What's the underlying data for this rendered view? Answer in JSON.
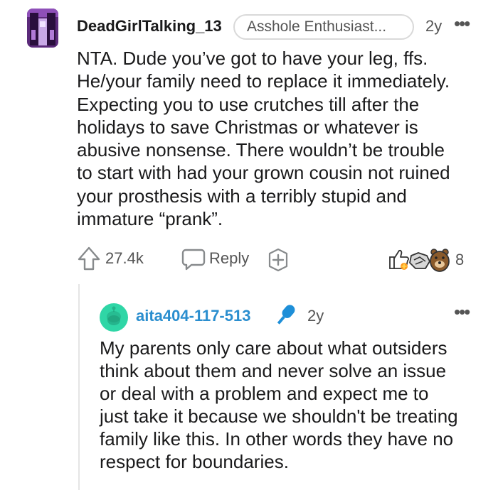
{
  "comment": {
    "username": "DeadGirlTalking_13",
    "flair": "Asshole Enthusiast...",
    "age": "2y",
    "more": "•••",
    "lines": [
      "NTA. Dude you’ve got to have your leg, ffs.",
      "He/your family need to replace it immediately.",
      "Expecting you to use crutches till after the",
      "holidays to save Christmas or whatever is",
      "abusive nonsense. There wouldn’t be trouble",
      "to start with had your grown cousin not ruined",
      "your prosthesis with a terribly stupid and",
      "immature “prank”."
    ],
    "score": "27.4k",
    "reply_label": "Reply",
    "award_count": "8"
  },
  "reply": {
    "username": "aita404-117-513",
    "age": "2y",
    "more": "•••",
    "lines": [
      "My parents only care about what outsiders",
      "think about them and never solve an issue",
      "or deal with a problem and expect me to",
      "just take it because we shouldn't be treating",
      "family like this. In other words they have no",
      "respect for boundaries."
    ]
  },
  "colors": {
    "text": "#1a1a1b",
    "meta": "#555555",
    "link_blue": "#2a8ecf",
    "reply_avatar": "#2fd6a6",
    "mic_blue": "#1e8fd8"
  },
  "icons": {
    "upvote": "upvote-arrow-icon",
    "reply": "speech-bubble-icon",
    "award": "plus-award-icon",
    "mic": "microphone-icon"
  }
}
